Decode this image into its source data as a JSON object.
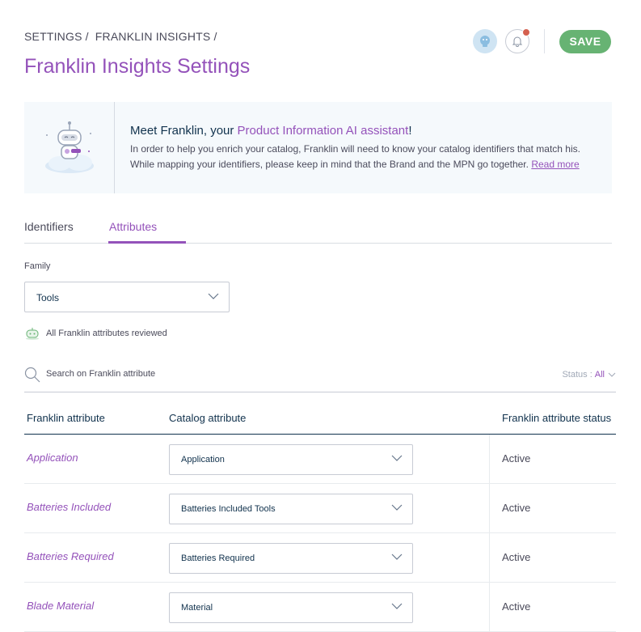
{
  "breadcrumb": [
    "SETTINGS",
    "/",
    "FRANKLIN INSIGHTS",
    "/"
  ],
  "page_title": "Franklin Insights Settings",
  "header": {
    "save_label": "SAVE",
    "accent_color": "#9452ba",
    "save_color": "#67b373",
    "notification_color": "#d4604f"
  },
  "helper": {
    "title_prefix": "Meet Franklin, your ",
    "title_accent": "Product Information AI assistant",
    "title_suffix": "!",
    "line1": "In order to help you enrich your catalog, Franklin will need to know your catalog identifiers that match his.",
    "line2": "While mapping your identifiers, please keep in mind that the Brand and the MPN go together.",
    "read_more": "Read more"
  },
  "tabs": [
    {
      "label": "Identifiers",
      "active": false
    },
    {
      "label": "Attributes",
      "active": true
    }
  ],
  "family": {
    "label": "Family",
    "value": "Tools"
  },
  "reviewed_text": "All Franklin attributes reviewed",
  "search": {
    "placeholder": "Search on Franklin attribute",
    "status_label": "Status :",
    "status_value": "All"
  },
  "table": {
    "headers": [
      "Franklin attribute",
      "Catalog attribute",
      "Franklin attribute status"
    ],
    "rows": [
      {
        "franklin": "Application",
        "catalog": "Application",
        "status": "Active"
      },
      {
        "franklin": "Batteries Included",
        "catalog": "Batteries Included Tools",
        "status": "Active"
      },
      {
        "franklin": "Batteries Required",
        "catalog": "Batteries Required",
        "status": "Active"
      },
      {
        "franklin": "Blade Material",
        "catalog": "Material",
        "status": "Active"
      }
    ]
  }
}
